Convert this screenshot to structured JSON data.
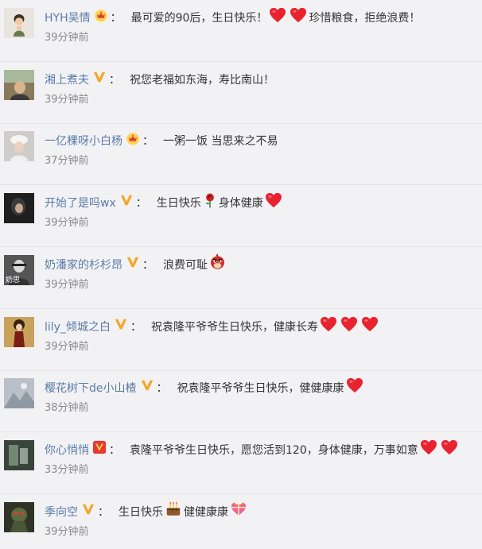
{
  "comments": [
    {
      "username": "HYH吴情",
      "badge": "crown",
      "segments": [
        {
          "t": "text",
          "v": "最可爱的90后，生日快乐！"
        },
        {
          "t": "emoji",
          "icon": "heart-icon"
        },
        {
          "t": "emoji",
          "icon": "heart-icon"
        },
        {
          "t": "text",
          "v": "珍惜粮食，拒绝浪费！"
        }
      ],
      "time": "39分钟前",
      "avatar_color": "#d9d6cf"
    },
    {
      "username": "湘上煮夫",
      "badge": "v-yellow",
      "segments": [
        {
          "t": "text",
          "v": "祝您老福如东海，寿比南山！"
        }
      ],
      "time": "39分钟前",
      "avatar_color": "#6b5e4a"
    },
    {
      "username": "一亿棵呀小白杨",
      "badge": "crown",
      "segments": [
        {
          "t": "text",
          "v": "一粥一饭 当思来之不易"
        }
      ],
      "time": "37分钟前",
      "avatar_color": "#c9c6c4"
    },
    {
      "username": "开始了是吗wx",
      "badge": "v-yellow",
      "segments": [
        {
          "t": "text",
          "v": "生日快乐"
        },
        {
          "t": "emoji",
          "icon": "rose-icon"
        },
        {
          "t": "text",
          "v": "身体健康"
        },
        {
          "t": "emoji",
          "icon": "heart-icon"
        }
      ],
      "time": "39分钟前",
      "avatar_color": "#2a2a2a"
    },
    {
      "username": "奶潘家的杉杉昂",
      "badge": "v-yellow",
      "segments": [
        {
          "t": "text",
          "v": "浪费可耻"
        },
        {
          "t": "emoji",
          "icon": "angry-bird-icon"
        }
      ],
      "time": "39分钟前",
      "avatar_color": "#5a5a5a",
      "avatar_text": "奶思"
    },
    {
      "username": "lily_倾城之白",
      "badge": "v-yellow",
      "segments": [
        {
          "t": "text",
          "v": "祝袁隆平爷爷生日快乐，健康长寿"
        },
        {
          "t": "emoji",
          "icon": "heart-icon"
        },
        {
          "t": "emoji",
          "icon": "heart-icon"
        },
        {
          "t": "emoji",
          "icon": "heart-icon"
        }
      ],
      "time": "39分钟前",
      "avatar_color": "#5b3a1e"
    },
    {
      "username": "樱花树下de小山楂",
      "badge": "v-yellow",
      "segments": [
        {
          "t": "text",
          "v": "祝袁隆平爷爷生日快乐，健健康康"
        },
        {
          "t": "emoji",
          "icon": "heart-icon"
        }
      ],
      "time": "38分钟前",
      "avatar_color": "#9aa3ad"
    },
    {
      "username": "你心悄悄",
      "badge": "v-red",
      "segments": [
        {
          "t": "text",
          "v": "袁隆平爷爷生日快乐，愿您活到120，身体健康，万事如意"
        },
        {
          "t": "emoji",
          "icon": "heart-icon"
        },
        {
          "t": "emoji",
          "icon": "heart-icon"
        }
      ],
      "time": "33分钟前",
      "avatar_color": "#3d4a3a"
    },
    {
      "username": "季向空",
      "badge": "v-yellow",
      "segments": [
        {
          "t": "text",
          "v": "生日快乐"
        },
        {
          "t": "emoji",
          "icon": "cake-icon"
        },
        {
          "t": "text",
          "v": "健健康康"
        },
        {
          "t": "emoji",
          "icon": "gift-heart-icon"
        }
      ],
      "time": "39分钟前",
      "avatar_color": "#3a3f2e"
    }
  ],
  "colon": "："
}
